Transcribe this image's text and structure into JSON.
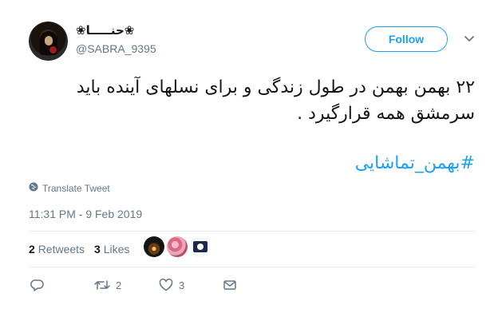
{
  "header": {
    "display_name": "❀حنـــــا❀",
    "handle": "@SABRA_9395",
    "follow_label": "Follow"
  },
  "tweet": {
    "text": "۲۲ بهمن بهمن در طول زندگی و برای نسلهای آینده باید سرمشق همه قرارگیرد .",
    "hashtag": "#بهمن_تماشایی",
    "translate_label": "Translate Tweet",
    "timestamp": "11:31 PM - 9 Feb 2019"
  },
  "stats": {
    "retweets_count": "2",
    "retweets_label": "Retweets",
    "likes_count": "3",
    "likes_label": "Likes"
  },
  "actions": {
    "retweet_count": "2",
    "like_count": "3"
  }
}
